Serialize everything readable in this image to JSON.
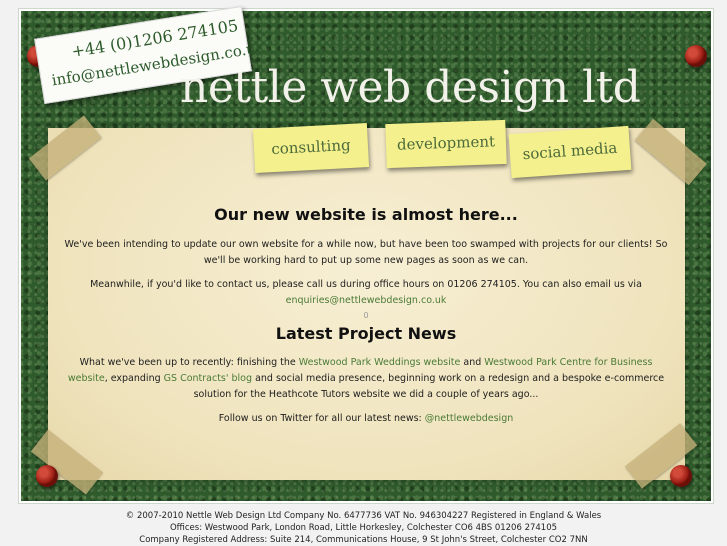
{
  "contact": {
    "phone": "+44 (0)1206 274105",
    "email": "info@nettlewebdesign.co.uk"
  },
  "header": {
    "title": "nettle web design ltd"
  },
  "nav": [
    {
      "label": "consulting"
    },
    {
      "label": "development"
    },
    {
      "label": "social media"
    }
  ],
  "main": {
    "heading": "Our new website is almost here...",
    "intro": "We've been intending to update our own website for a while now, but have been too swamped with projects for our clients! So we'll be working hard to put up some new pages as soon as we can.",
    "contact_text": "Meanwhile, if you'd like to contact us, please call us during office hours on 01206 274105. You can also email us via",
    "contact_email": "enquiries@nettlewebdesign.co.uk",
    "separator": "0",
    "news_heading": "Latest Project News",
    "news_part1": "What we've been up to recently: finishing the",
    "news_link1": "Westwood Park Weddings website",
    "news_part2": "and",
    "news_link2": "Westwood Park Centre for Business website",
    "news_part3": ", expanding",
    "news_link3": "GS Contracts' blog",
    "news_part4": "and social media presence, beginning work on a redesign and a bespoke e-commerce solution for the Heathcote Tutors website we did a couple of years ago...",
    "twitter_text": "Follow us on Twitter for all our latest news:",
    "twitter_handle": "@nettlewebdesign"
  },
  "footer": {
    "line1": "© 2007-2010 Nettle Web Design Ltd    Company No. 6477736    VAT No. 946304227    Registered in England & Wales",
    "line2": "Offices: Westwood Park, London Road, Little Horkesley, Colchester CO6 4BS    01206 274105",
    "line3": "Company Registered Address: Suite 214, Communications House, 9 St John's Street, Colchester CO2 7NN"
  },
  "colors": {
    "board_green": "#2f5a2c",
    "paper": "#f0e6c2",
    "postit": "#f3f08d",
    "link_green": "#4a7a36"
  }
}
